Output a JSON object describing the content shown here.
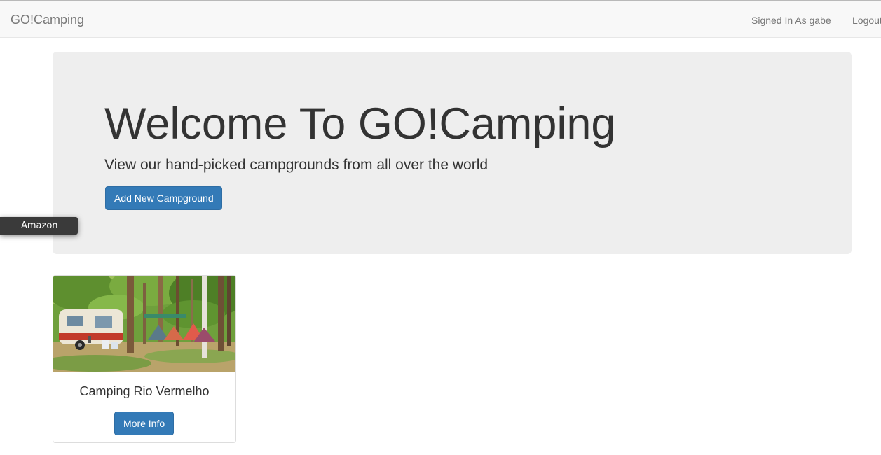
{
  "navbar": {
    "brand": "GO!Camping",
    "signed_in": "Signed In As gabe",
    "logout": "Logout"
  },
  "jumbotron": {
    "title": "Welcome To GO!Camping",
    "subtitle": "View our hand-picked campgrounds from all over the world",
    "add_button": "Add New Campground"
  },
  "amazon_tab": {
    "label": "Amazon"
  },
  "campgrounds": [
    {
      "name": "Camping Rio Vermelho",
      "button": "More Info"
    }
  ],
  "colors": {
    "primary": "#337ab7",
    "jumbotron_bg": "#eeeeee",
    "navbar_bg": "#f8f8f8"
  }
}
